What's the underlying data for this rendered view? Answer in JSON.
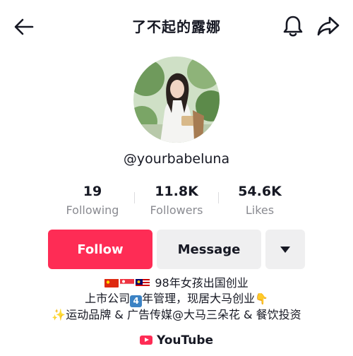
{
  "header": {
    "title": "了不起的露娜",
    "icons": {
      "back": "arrow-left-icon",
      "notifications": "bell-icon",
      "share": "share-arrow-icon"
    }
  },
  "profile": {
    "handle": "@yourbabeluna",
    "stats": [
      {
        "value": "19",
        "label": "Following"
      },
      {
        "value": "11.8K",
        "label": "Followers"
      },
      {
        "value": "54.6K",
        "label": "Likes"
      }
    ]
  },
  "actions": {
    "follow_label": "Follow",
    "message_label": "Message",
    "more_icon": "caret-down-icon"
  },
  "bio": {
    "line1": "98年女孩出国创业",
    "line2_a": "上市公司",
    "line2_badge": "4",
    "line2_b": "年管理，现居大马创业",
    "line3": "运动品牌 & 广告传媒@大马三朵花  & 餐饮投资"
  },
  "link": {
    "label": "YouTube",
    "icon": "youtube-icon"
  },
  "colors": {
    "primary": "#fe2c55",
    "secondary_bg": "#efeff0",
    "muted_text": "#8a8b91"
  }
}
